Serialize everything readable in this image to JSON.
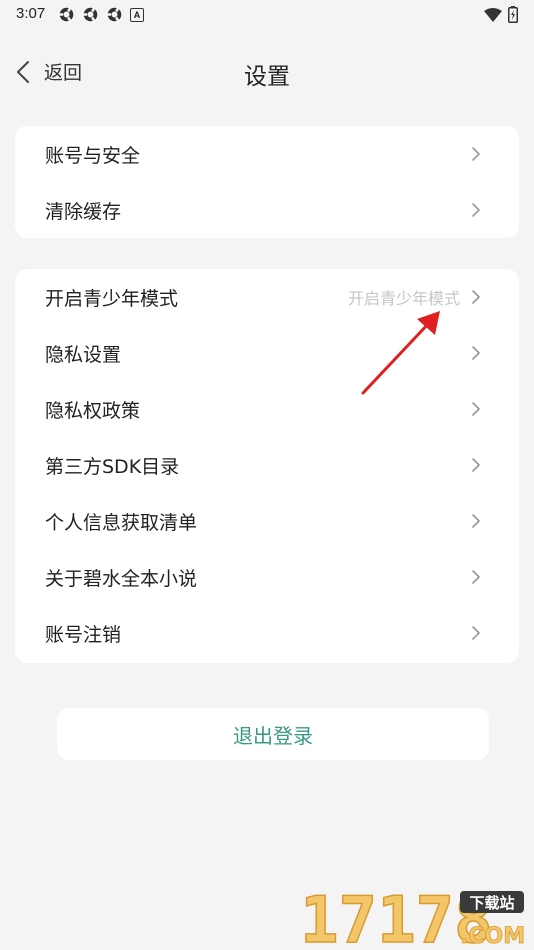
{
  "status": {
    "time": "3:07",
    "app_badge": "A"
  },
  "nav": {
    "back_label": "返回",
    "title": "设置"
  },
  "group1": [
    {
      "label": "账号与安全"
    },
    {
      "label": "清除缓存"
    }
  ],
  "group2": [
    {
      "label": "开启青少年模式",
      "value": "开启青少年模式"
    },
    {
      "label": "隐私设置"
    },
    {
      "label": "隐私权政策"
    },
    {
      "label": "第三方SDK目录"
    },
    {
      "label": "个人信息获取清单"
    },
    {
      "label": "关于碧水全本小说"
    },
    {
      "label": "账号注销"
    }
  ],
  "logout_label": "退出登录",
  "watermark": {
    "digits": "17178",
    "badge": "下载站",
    "suffix": ".COM"
  },
  "colors": {
    "accent": "#3a9a84",
    "arrow": "#e02020",
    "background": "#f4f4f4"
  },
  "icons": [
    "gear-icon",
    "wifi-icon",
    "battery-icon",
    "back-chevron-icon",
    "chevron-right-icon",
    "arrow-annotation"
  ]
}
